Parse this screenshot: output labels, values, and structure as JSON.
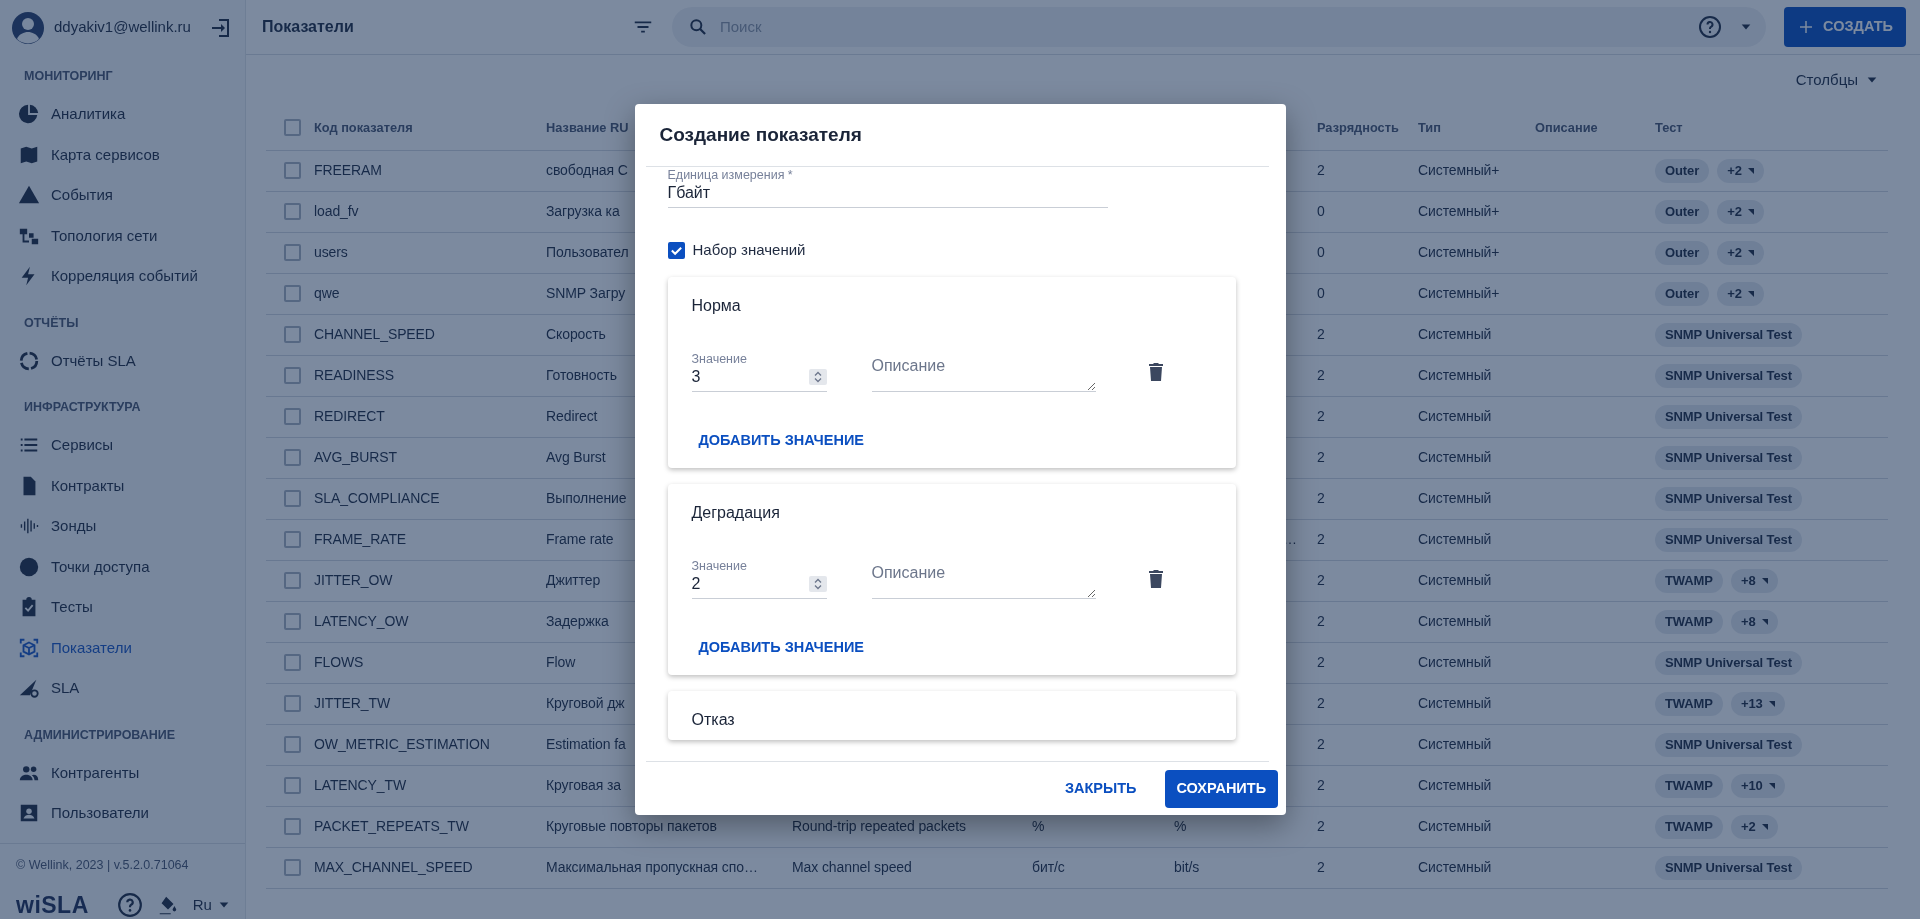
{
  "user": {
    "email": "ddyakiv1@wellink.ru"
  },
  "sidebar": {
    "sections": [
      {
        "title": "МОНИТОРИНГ",
        "items": [
          {
            "label": "Аналитика",
            "selected": false
          },
          {
            "label": "Карта сервисов",
            "selected": false
          },
          {
            "label": "События",
            "selected": false
          },
          {
            "label": "Топология сети",
            "selected": false
          },
          {
            "label": "Корреляция событий",
            "selected": false
          }
        ]
      },
      {
        "title": "ОТЧЁТЫ",
        "items": [
          {
            "label": "Отчёты SLA",
            "selected": false
          }
        ]
      },
      {
        "title": "ИНФРАСТРУКТУРА",
        "items": [
          {
            "label": "Сервисы",
            "selected": false
          },
          {
            "label": "Контракты",
            "selected": false
          },
          {
            "label": "Зонды",
            "selected": false
          },
          {
            "label": "Точки доступа",
            "selected": false
          },
          {
            "label": "Тесты",
            "selected": false
          },
          {
            "label": "Показатели",
            "selected": true
          },
          {
            "label": "SLA",
            "selected": false
          }
        ]
      },
      {
        "title": "АДМИНИСТРИРОВАНИЕ",
        "items": [
          {
            "label": "Контрагенты",
            "selected": false
          },
          {
            "label": "Пользователи",
            "selected": false
          }
        ]
      }
    ],
    "footer": {
      "copyright": "© Wellink, 2023 | v.5.2.0.71064",
      "logo": "wiSLA",
      "language": "Ru"
    }
  },
  "header": {
    "title": "Показатели",
    "search_placeholder": "Поиск",
    "create_button": "СОЗДАТЬ"
  },
  "columns_button": "Столбцы",
  "table": {
    "header_checked": false,
    "columns": [
      "Код показателя",
      "Название RU",
      null,
      null,
      null,
      "Разрядность",
      "Тип",
      "Описание",
      "Тест"
    ],
    "rows": [
      {
        "checked": false,
        "cells": [
          "FREERAM",
          "свободная С",
          null,
          null,
          null,
          "2",
          "Системный+",
          null
        ],
        "tests": [
          {
            "label": "Outer",
            "kind": "test"
          },
          {
            "label": "+2",
            "kind": "more"
          }
        ]
      },
      {
        "checked": false,
        "cells": [
          "load_fv",
          "Загрузка ка",
          null,
          null,
          null,
          "0",
          "Системный+",
          null
        ],
        "tests": [
          {
            "label": "Outer",
            "kind": "test"
          },
          {
            "label": "+2",
            "kind": "more"
          }
        ]
      },
      {
        "checked": false,
        "cells": [
          "users",
          "Пользовател",
          null,
          null,
          null,
          "0",
          "Системный+",
          null
        ],
        "tests": [
          {
            "label": "Outer",
            "kind": "test"
          },
          {
            "label": "+2",
            "kind": "more"
          }
        ]
      },
      {
        "checked": false,
        "cells": [
          "qwe",
          "SNMP Загру",
          null,
          null,
          null,
          "0",
          "Системный+",
          null
        ],
        "tests": [
          {
            "label": "Outer",
            "kind": "test"
          },
          {
            "label": "+2",
            "kind": "more"
          }
        ]
      },
      {
        "checked": false,
        "cells": [
          "CHANNEL_SPEED",
          "Скорость",
          null,
          null,
          null,
          "2",
          "Системный",
          null
        ],
        "tests": [
          {
            "label": "SNMP Universal Test",
            "kind": "test"
          }
        ]
      },
      {
        "checked": false,
        "cells": [
          "READINESS",
          "Готовность",
          null,
          null,
          null,
          "2",
          "Системный",
          null
        ],
        "tests": [
          {
            "label": "SNMP Universal Test",
            "kind": "test"
          }
        ]
      },
      {
        "checked": false,
        "cells": [
          "REDIRECT",
          "Redirect",
          null,
          null,
          null,
          "2",
          "Системный",
          null
        ],
        "tests": [
          {
            "label": "SNMP Universal Test",
            "kind": "test"
          }
        ]
      },
      {
        "checked": false,
        "cells": [
          "AVG_BURST",
          "Avg Burst",
          null,
          null,
          null,
          "2",
          "Системный",
          null
        ],
        "tests": [
          {
            "label": "SNMP Universal Test",
            "kind": "test"
          }
        ]
      },
      {
        "checked": false,
        "cells": [
          "SLA_COMPLIANCE",
          "Выполнение",
          null,
          null,
          null,
          "2",
          "Системный",
          null
        ],
        "tests": [
          {
            "label": "SNMP Universal Test",
            "kind": "test"
          }
        ]
      },
      {
        "checked": false,
        "cells": [
          "FRAME_RATE",
          "Frame rate",
          null,
          null,
          {
            "text": "…",
            "kind": "tail"
          },
          "2",
          "Системный",
          null
        ],
        "tests": [
          {
            "label": "SNMP Universal Test",
            "kind": "test"
          }
        ]
      },
      {
        "checked": false,
        "cells": [
          "JITTER_OW",
          "Джиттер",
          null,
          null,
          null,
          "2",
          "Системный",
          null
        ],
        "tests": [
          {
            "label": "TWAMP",
            "kind": "test"
          },
          {
            "label": "+8",
            "kind": "more"
          }
        ]
      },
      {
        "checked": false,
        "cells": [
          "LATENCY_OW",
          "Задержка",
          null,
          null,
          null,
          "2",
          "Системный",
          null
        ],
        "tests": [
          {
            "label": "TWAMP",
            "kind": "test"
          },
          {
            "label": "+8",
            "kind": "more"
          }
        ]
      },
      {
        "checked": false,
        "cells": [
          "FLOWS",
          "Flow",
          null,
          null,
          null,
          "2",
          "Системный",
          null
        ],
        "tests": [
          {
            "label": "SNMP Universal Test",
            "kind": "test"
          }
        ]
      },
      {
        "checked": false,
        "cells": [
          "JITTER_TW",
          "Круговой дж",
          null,
          null,
          null,
          "2",
          "Системный",
          null
        ],
        "tests": [
          {
            "label": "TWAMP",
            "kind": "test"
          },
          {
            "label": "+13",
            "kind": "more"
          }
        ]
      },
      {
        "checked": false,
        "cells": [
          "OW_METRIC_ESTIMATION",
          "Estimation fa",
          null,
          null,
          null,
          "2",
          "Системный",
          null
        ],
        "tests": [
          {
            "label": "SNMP Universal Test",
            "kind": "test"
          }
        ]
      },
      {
        "checked": false,
        "cells": [
          "LATENCY_TW",
          "Круговая за",
          null,
          null,
          null,
          "2",
          "Системный",
          null
        ],
        "tests": [
          {
            "label": "TWAMP",
            "kind": "test"
          },
          {
            "label": "+10",
            "kind": "more"
          }
        ]
      },
      {
        "checked": false,
        "cells": [
          "PACKET_REPEATS_TW",
          "Круговые повторы пакетов",
          "Round-trip repeated packets",
          "%",
          "%",
          "2",
          "Системный",
          null
        ],
        "tests": [
          {
            "label": "TWAMP",
            "kind": "test"
          },
          {
            "label": "+2",
            "kind": "more"
          }
        ]
      },
      {
        "checked": false,
        "cells": [
          "MAX_CHANNEL_SPEED",
          "Максимальная пропускная спо…",
          "Max channel speed",
          "бит/с",
          "bit/s",
          "2",
          "Системный",
          null
        ],
        "tests": [
          {
            "label": "SNMP Universal Test",
            "kind": "test"
          }
        ]
      }
    ]
  },
  "dialog": {
    "title": "Создание показателя",
    "unit_field": {
      "label": "Единица измерения *",
      "value": "Гбайт"
    },
    "value_set": {
      "label": "Набор значений",
      "checked": true
    },
    "groups": [
      {
        "title": "Норма",
        "values": [
          {
            "label": "Значение",
            "value": "3",
            "description_placeholder": "Описание"
          }
        ],
        "add_button": "ДОБАВИТЬ ЗНАЧЕНИЕ"
      },
      {
        "title": "Деградация",
        "values": [
          {
            "label": "Значение",
            "value": "2",
            "description_placeholder": "Описание"
          }
        ],
        "add_button": "ДОБАВИТЬ ЗНАЧЕНИЕ"
      },
      {
        "title": "Отказ"
      }
    ],
    "buttons": [
      {
        "label": "ЗАКРЫТЬ",
        "kind": "text"
      },
      {
        "label": "СОХРАНИТЬ",
        "kind": "primary"
      }
    ]
  }
}
